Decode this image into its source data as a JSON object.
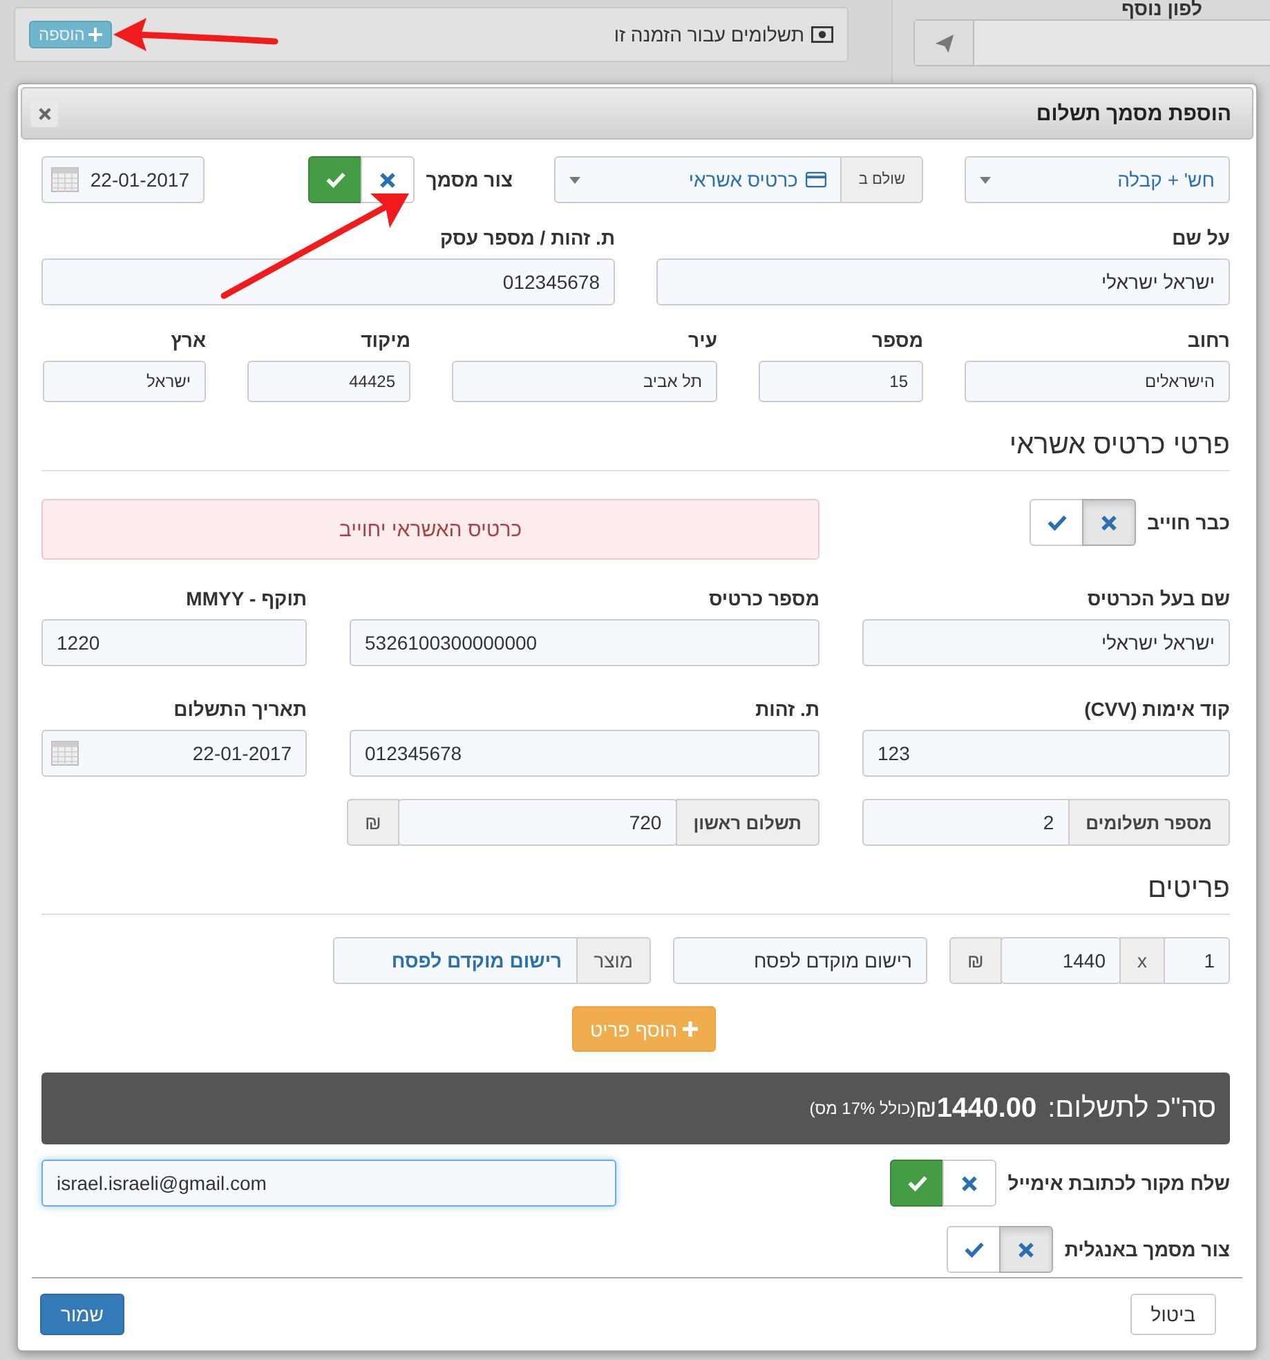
{
  "background": {
    "panel": {
      "title": "תשלומים עבור הזמנה זו",
      "add_button": "הוספה"
    },
    "side_label": "לפון נוסף"
  },
  "modal": {
    "title": "הוספת מסמך תשלום",
    "header": {
      "document_type": "חש' + קבלה",
      "paid_by": {
        "addon": "שולם ב",
        "value": "כרטיס אשראי"
      },
      "create_document": {
        "label": "צור מסמך",
        "on": true
      },
      "date": "22-01-2017"
    },
    "customer": [
      {
        "label": "על שם",
        "value": "ישראל ישראלי"
      },
      {
        "label": "ת. זהות / מספר עסק",
        "value": "012345678"
      }
    ],
    "address": [
      {
        "label": "רחוב",
        "value": "הישראלים"
      },
      {
        "label": "מספר",
        "value": "15"
      },
      {
        "label": "עיר",
        "value": "תל אביב"
      },
      {
        "label": "מיקוד",
        "value": "44425"
      },
      {
        "label": "ארץ",
        "value": "ישראל"
      }
    ],
    "credit_card": {
      "title": "פרטי כרטיס אשראי",
      "already_charged": {
        "label": "כבר חוייב",
        "on": false
      },
      "alert": "כרטיס האשראי יחוייב",
      "fields": [
        {
          "label": "שם בעל הכרטיס",
          "value": "ישראל ישראלי",
          "kind": "text"
        },
        {
          "label": "מספר כרטיס",
          "value": "5326100300000000",
          "kind": "number"
        },
        {
          "label": "תוקף - MMYY",
          "value": "1220",
          "kind": "number"
        },
        {
          "label": "קוד אימות (CVV)",
          "value": "123",
          "kind": "number"
        },
        {
          "label": "ת. זהות",
          "value": "012345678",
          "kind": "number"
        },
        {
          "label": "תאריך התשלום",
          "value": "22-01-2017",
          "kind": "date"
        }
      ],
      "installments": {
        "addon": "מספר תשלומים",
        "value": "2"
      },
      "first_payment": {
        "addon": "תשלום ראשון",
        "value": "720",
        "currency": "₪"
      }
    },
    "items": {
      "title": "פריטים",
      "rows": [
        {
          "quantity": "1",
          "times": "x",
          "price": "1440",
          "currency": "₪",
          "description": "רישום מוקדם לפסח",
          "product_addon": "מוצר",
          "product": "רישום מוקדם לפסח"
        }
      ],
      "add_button": "הוסף פריט"
    },
    "total": {
      "label": "סה\"כ לתשלום:",
      "amount": "1440.00",
      "currency": "₪",
      "tax_note": "(כולל 17% מס)"
    },
    "send_email": {
      "label": "שלח מקור לכתובת אימייל",
      "on": true,
      "email": "israel.israeli@gmail.com"
    },
    "english_document": {
      "label": "צור מסמך באנגלית",
      "on": false
    },
    "buttons": {
      "cancel": "ביטול",
      "save": "שמור"
    }
  }
}
